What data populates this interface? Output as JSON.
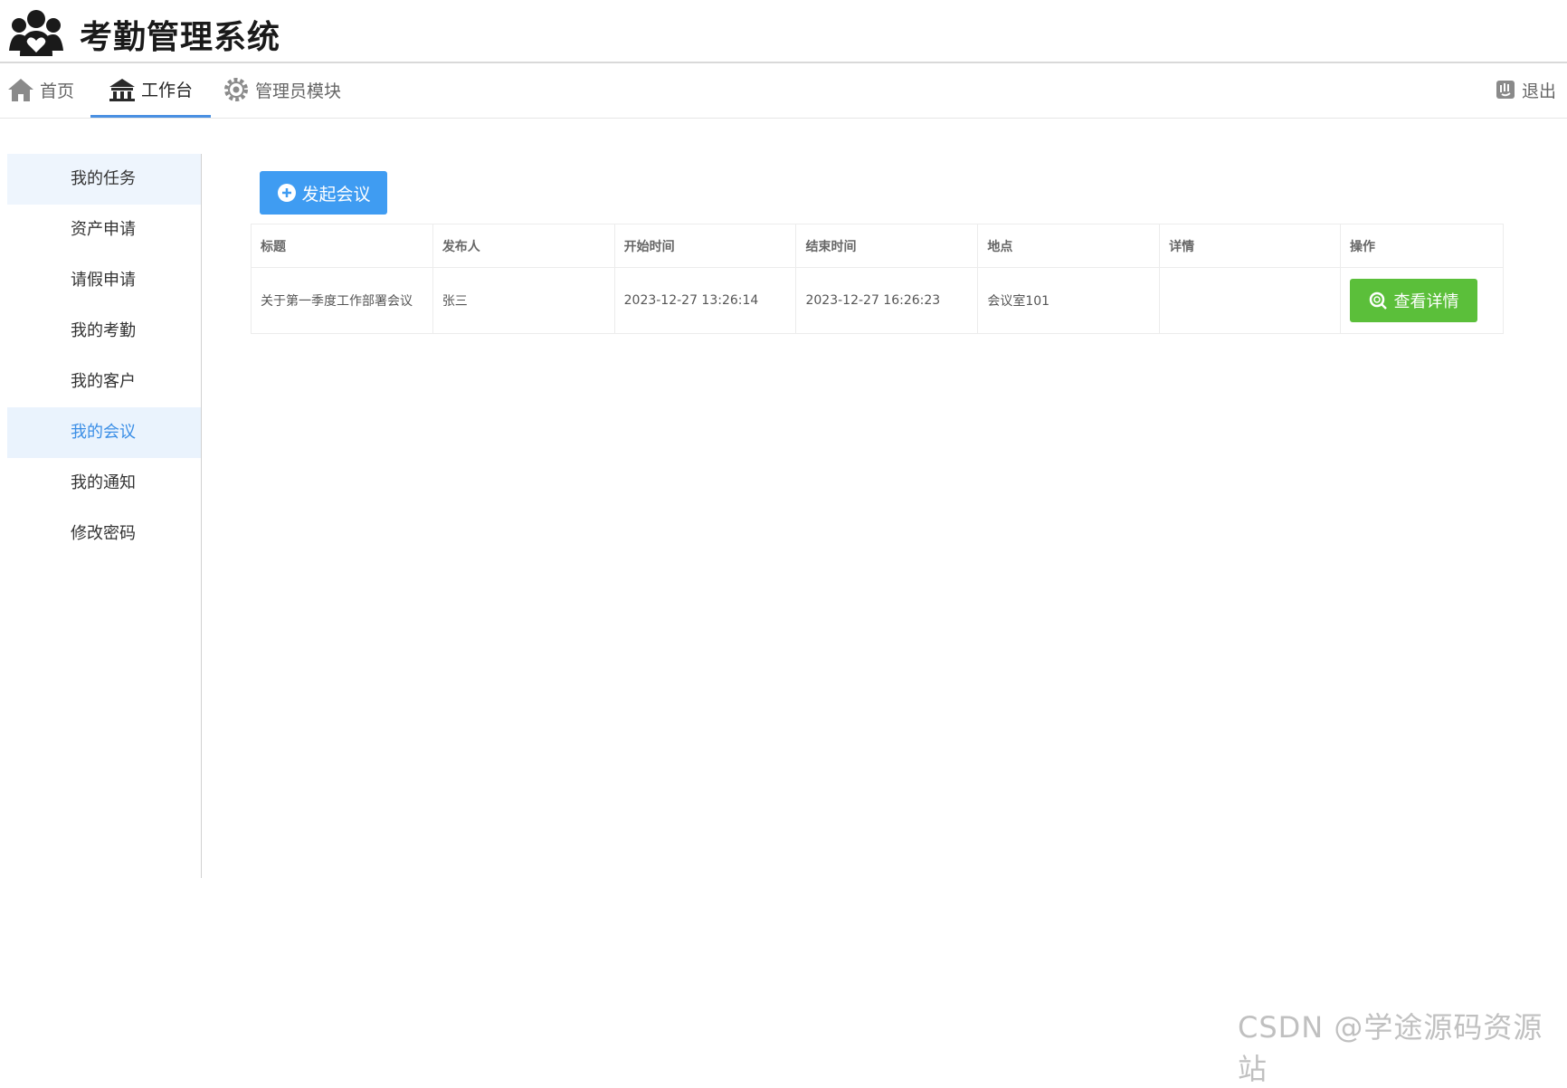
{
  "app": {
    "title": "考勤管理系统"
  },
  "nav": {
    "home": "首页",
    "workbench": "工作台",
    "admin": "管理员模块",
    "logout": "退出"
  },
  "sidebar": {
    "items": [
      {
        "label": "我的任务"
      },
      {
        "label": "资产申请"
      },
      {
        "label": "请假申请"
      },
      {
        "label": "我的考勤"
      },
      {
        "label": "我的客户"
      },
      {
        "label": "我的会议"
      },
      {
        "label": "我的通知"
      },
      {
        "label": "修改密码"
      }
    ],
    "active": "我的会议"
  },
  "main": {
    "new_button": "发起会议",
    "columns": [
      "标题",
      "发布人",
      "开始时间",
      "结束时间",
      "地点",
      "详情",
      "操作"
    ],
    "rows": [
      {
        "title": "关于第一季度工作部署会议",
        "publisher": "张三",
        "start": "2023-12-27 13:26:14",
        "end": "2023-12-27 16:26:23",
        "location": "会议室101",
        "detail": "",
        "action": "查看详情"
      }
    ]
  },
  "watermark": "CSDN @学途源码资源站",
  "colors": {
    "accent": "#3f9cf2",
    "success": "#5bbf3a",
    "active_text": "#3a8ee6"
  }
}
